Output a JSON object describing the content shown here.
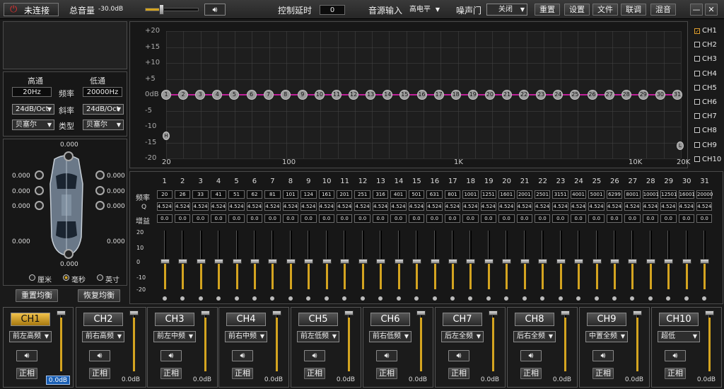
{
  "topbar": {
    "power_label": "未连接",
    "volume_label": "总音量",
    "volume_value": "-30.0dB",
    "volume_level": 0.3,
    "delay_label": "控制延时",
    "delay_value": "0",
    "source_label": "音源输入",
    "source_value": "高电平",
    "noise_gate_label": "噪声门",
    "noise_gate_value": "关闭",
    "buttons": [
      "重置",
      "设置",
      "文件",
      "联调",
      "混音"
    ]
  },
  "crossover": {
    "highpass_label": "高通",
    "lowpass_label": "低通",
    "freq_label": "频率",
    "slope_label": "斜率",
    "type_label": "类型",
    "hp_freq": "20Hz",
    "lp_freq": "20000Hz",
    "hp_slope": "24dB/Oct",
    "lp_slope": "24dB/Oct",
    "hp_type": "贝塞尔",
    "lp_type": "贝塞尔"
  },
  "delay": {
    "values": [
      "0.000",
      "0.000",
      "0.000",
      "0.000",
      "0.000",
      "0.000",
      "0.000",
      "0.000",
      "0.000",
      "0.000"
    ],
    "units": [
      "厘米",
      "毫秒",
      "英寸"
    ],
    "reset_label": "重置均衡",
    "restore_label": "恢复均衡"
  },
  "graph": {
    "y_labels": [
      "+20",
      "+15",
      "+10",
      "+5",
      "0dB",
      "-5",
      "-10",
      "-15",
      "-20"
    ],
    "x_labels": [
      "20",
      "100",
      "1K",
      "10K",
      "20K"
    ],
    "nodes": [
      "1",
      "2",
      "3",
      "4",
      "5",
      "6",
      "7",
      "8",
      "9",
      "10",
      "11",
      "12",
      "13",
      "14",
      "15",
      "16",
      "17",
      "18",
      "19",
      "20",
      "21",
      "22",
      "23",
      "24",
      "25",
      "26",
      "27",
      "28",
      "29",
      "30",
      "31"
    ],
    "hp_marker": "H",
    "lp_marker": "L",
    "line_color": "#c0209a"
  },
  "channels_list": [
    "CH1",
    "CH2",
    "CH3",
    "CH4",
    "CH5",
    "CH6",
    "CH7",
    "CH8",
    "CH9",
    "CH10"
  ],
  "eq": {
    "freq_label": "频率",
    "q_label": "Q",
    "gain_label": "增益",
    "band_numbers": [
      "1",
      "2",
      "3",
      "4",
      "5",
      "6",
      "7",
      "8",
      "9",
      "10",
      "11",
      "12",
      "13",
      "14",
      "15",
      "16",
      "17",
      "18",
      "19",
      "20",
      "21",
      "22",
      "23",
      "24",
      "25",
      "26",
      "27",
      "28",
      "29",
      "30",
      "31"
    ],
    "freqs": [
      "20",
      "26",
      "33",
      "41",
      "51",
      "62",
      "81",
      "101",
      "124",
      "161",
      "201",
      "251",
      "316",
      "401",
      "501",
      "631",
      "801",
      "1001",
      "1251",
      "1601",
      "2001",
      "2501",
      "3151",
      "4001",
      "5001",
      "6299",
      "8001",
      "10001",
      "12501",
      "16001",
      "20000"
    ],
    "q": "4.524",
    "gain": "0.0",
    "scale": [
      "20",
      "10",
      "0",
      "-10",
      "-20"
    ]
  },
  "channel_strips": [
    {
      "name": "CH1",
      "position": "前左高频",
      "gain": "0.0dB",
      "phase": "正相"
    },
    {
      "name": "CH2",
      "position": "前右高频",
      "gain": "0.0dB",
      "phase": "正相"
    },
    {
      "name": "CH3",
      "position": "前左中频",
      "gain": "0.0dB",
      "phase": "正相"
    },
    {
      "name": "CH4",
      "position": "前右中频",
      "gain": "0.0dB",
      "phase": "正相"
    },
    {
      "name": "CH5",
      "position": "前左低频",
      "gain": "0.0dB",
      "phase": "正相"
    },
    {
      "name": "CH6",
      "position": "前右低频",
      "gain": "0.0dB",
      "phase": "正相"
    },
    {
      "name": "CH7",
      "position": "后左全频",
      "gain": "0.0dB",
      "phase": "正相"
    },
    {
      "name": "CH8",
      "position": "后右全频",
      "gain": "0.0dB",
      "phase": "正相"
    },
    {
      "name": "CH9",
      "position": "中置全频",
      "gain": "0.0dB",
      "phase": "正相"
    },
    {
      "name": "CH10",
      "position": "超低",
      "gain": "0.0dB",
      "phase": "正相"
    }
  ],
  "colors": {
    "accent": "#d4a420",
    "curve": "#c0209a"
  }
}
